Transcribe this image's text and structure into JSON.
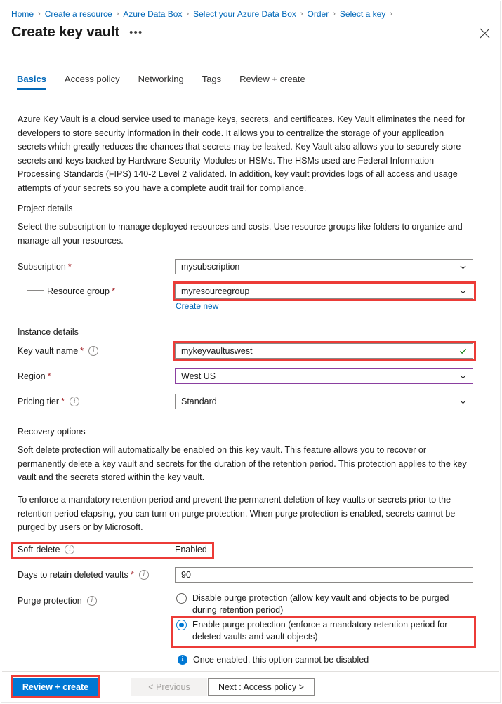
{
  "breadcrumb": {
    "items": [
      {
        "label": "Home"
      },
      {
        "label": "Create a resource"
      },
      {
        "label": "Azure Data Box"
      },
      {
        "label": "Select your Azure Data Box"
      },
      {
        "label": "Order"
      },
      {
        "label": "Select a key"
      }
    ],
    "separator": "›"
  },
  "header": {
    "title": "Create key vault",
    "more_label": "•••",
    "close_icon": "close-icon"
  },
  "tabs": [
    {
      "label": "Basics",
      "active": true
    },
    {
      "label": "Access policy",
      "active": false
    },
    {
      "label": "Networking",
      "active": false
    },
    {
      "label": "Tags",
      "active": false
    },
    {
      "label": "Review + create",
      "active": false
    }
  ],
  "intro": "Azure Key Vault is a cloud service used to manage keys, secrets, and certificates. Key Vault eliminates the need for developers to store security information in their code. It allows you to centralize the storage of your application secrets which greatly reduces the chances that secrets may be leaked. Key Vault also allows you to securely store secrets and keys backed by Hardware Security Modules or HSMs. The HSMs used are Federal Information Processing Standards (FIPS) 140-2 Level 2 validated. In addition, key vault provides logs of all access and usage attempts of your secrets so you have a complete audit trail for compliance.",
  "project_details": {
    "heading": "Project details",
    "description": "Select the subscription to manage deployed resources and costs. Use resource groups like folders to organize and manage all your resources.",
    "subscription": {
      "label": "Subscription",
      "required": "*",
      "value": "mysubscription"
    },
    "resource_group": {
      "label": "Resource group",
      "required": "*",
      "value": "myresourcegroup",
      "create_new": "Create new"
    }
  },
  "instance_details": {
    "heading": "Instance details",
    "key_vault_name": {
      "label": "Key vault name",
      "required": "*",
      "value": "mykeyvaultuswest",
      "validation_icon": "checkmark-icon"
    },
    "region": {
      "label": "Region",
      "required": "*",
      "value": "West US"
    },
    "pricing_tier": {
      "label": "Pricing tier",
      "required": "*",
      "value": "Standard"
    }
  },
  "recovery_options": {
    "heading": "Recovery options",
    "paragraph1": "Soft delete protection will automatically be enabled on this key vault. This feature allows you to recover or permanently delete a key vault and secrets for the duration of the retention period. This protection applies to the key vault and the secrets stored within the key vault.",
    "paragraph2": "To enforce a mandatory retention period and prevent the permanent deletion of key vaults or secrets prior to the retention period elapsing, you can turn on purge protection. When purge protection is enabled, secrets cannot be purged by users or by Microsoft.",
    "soft_delete": {
      "label": "Soft-delete",
      "value": "Enabled"
    },
    "days_to_retain": {
      "label": "Days to retain deleted vaults",
      "required": "*",
      "value": "90"
    },
    "purge_protection": {
      "label": "Purge protection",
      "options": [
        {
          "label": "Disable purge protection (allow key vault and objects to be purged during retention period)",
          "selected": false
        },
        {
          "label": "Enable purge protection (enforce a mandatory retention period for deleted vaults and vault objects)",
          "selected": true
        }
      ],
      "note": "Once enabled, this option cannot be disabled"
    }
  },
  "footer": {
    "review_create": "Review + create",
    "previous": "< Previous",
    "next": "Next : Access policy >"
  },
  "colors": {
    "accent": "#0078d4",
    "link": "#0067b8",
    "highlight": "#ec3b37",
    "required": "#a4262c",
    "success": "#107c10",
    "violet_border": "#8a3fa0"
  }
}
